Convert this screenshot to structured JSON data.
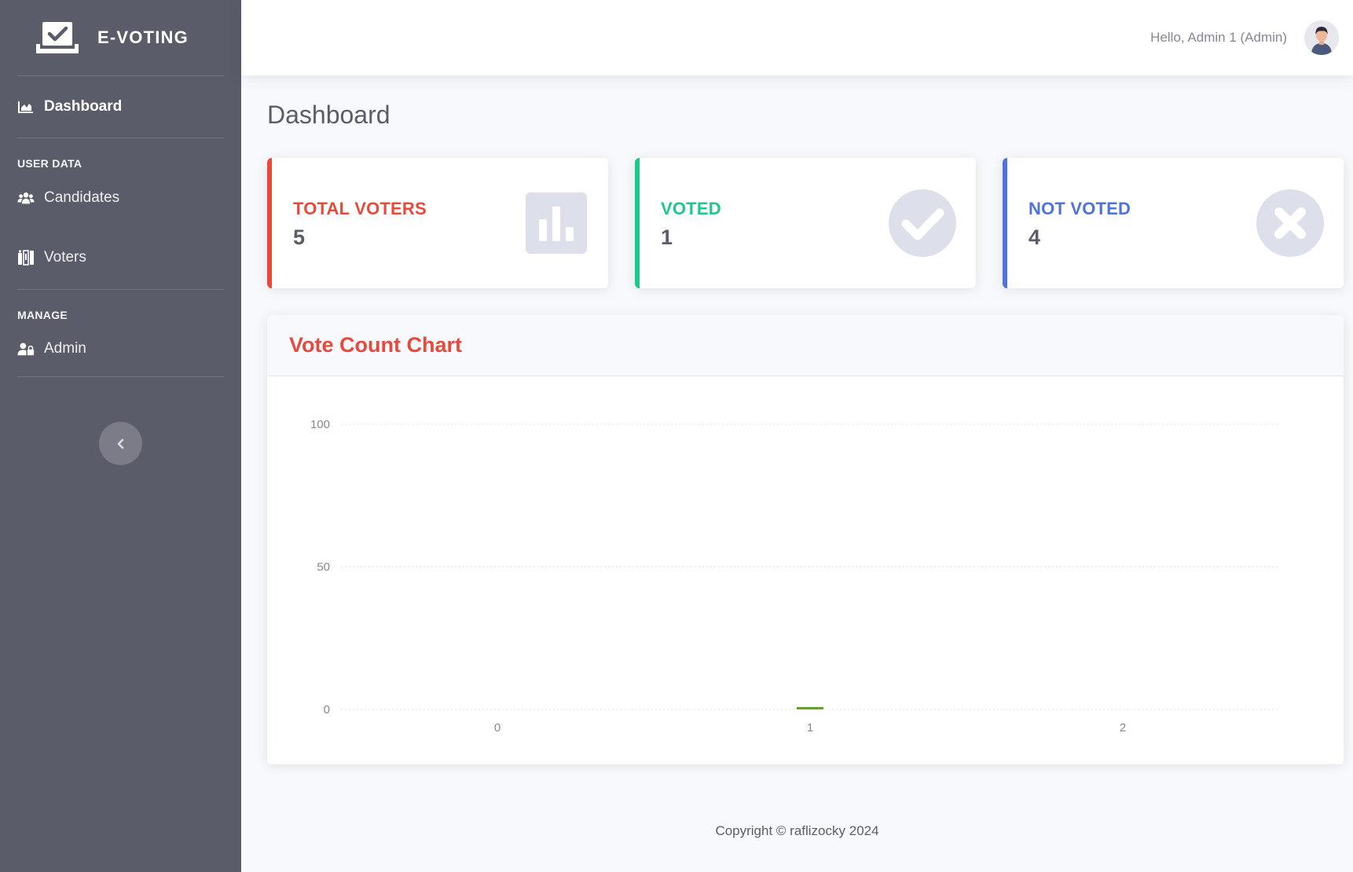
{
  "brand": {
    "name": "E-VOTING"
  },
  "sidebar": {
    "dashboard_label": "Dashboard",
    "section_user_data": "USER DATA",
    "candidates_label": "Candidates",
    "voters_label": "Voters",
    "section_manage": "MANAGE",
    "admin_label": "Admin"
  },
  "topbar": {
    "greeting": "Hello, Admin 1 (Admin)"
  },
  "page": {
    "title": "Dashboard"
  },
  "stats": {
    "total_voters": {
      "label": "TOTAL VOTERS",
      "value": "5",
      "icon": "bar-chart-icon",
      "color": "#e74a3b"
    },
    "voted": {
      "label": "VOTED",
      "value": "1",
      "icon": "check-circle-icon",
      "color": "#1cc88a"
    },
    "not_voted": {
      "label": "NOT VOTED",
      "value": "4",
      "icon": "times-circle-icon",
      "color": "#4e73df"
    }
  },
  "chart_card": {
    "title": "Vote Count Chart"
  },
  "chart_data": {
    "type": "bar",
    "categories": [
      "0",
      "1",
      "2"
    ],
    "values": [
      0,
      0,
      0
    ],
    "ylim": [
      0,
      100
    ],
    "yticks": [
      "0",
      "50",
      "100"
    ],
    "bar_color": "#6b9a3a",
    "grid": true
  },
  "footer": {
    "copyright": "Copyright © raflizocky 2024"
  }
}
